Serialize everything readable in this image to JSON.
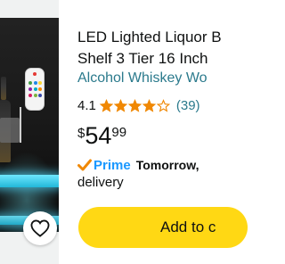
{
  "product": {
    "title_line1": "LED Lighted Liquor B",
    "title_line2": "Shelf 3 Tier 16 Inch",
    "brand": "Alcohol Whiskey Wo",
    "rating": "4.1",
    "rating_stars": 4.1,
    "review_count": "(39)",
    "price": {
      "currency": "$",
      "whole": "54",
      "fraction": "99"
    },
    "prime_label": "Prime",
    "delivery_day": "Tomorrow,",
    "delivery_label": "delivery"
  },
  "actions": {
    "add_to_cart": "Add to c",
    "wishlist_icon": "heart-outline-icon"
  },
  "colors": {
    "link": "#2b7a8c",
    "star": "#f08804",
    "prime": "#1a98ff",
    "button": "#ffd814",
    "panel": "#f0f2f2",
    "led": "#4fd8f5"
  }
}
